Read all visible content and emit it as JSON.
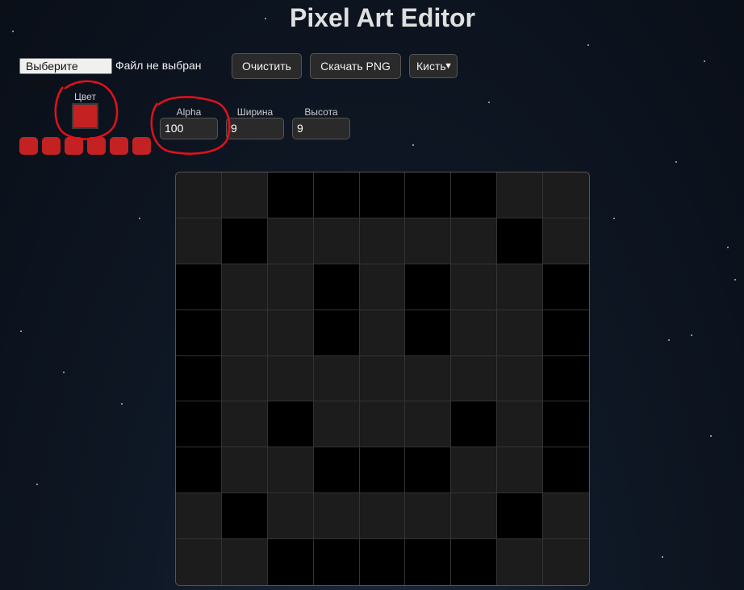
{
  "app_title": "Pixel Art Editor",
  "file_input": {
    "button_label": "Выберите файл",
    "status": "Файл не выбран"
  },
  "toolbar": {
    "clear_label": "Очистить",
    "download_label": "Скачать PNG",
    "tool_select_value": "Кисть"
  },
  "color": {
    "label": "Цвет",
    "value": "#c42222"
  },
  "alpha": {
    "label": "Alpha",
    "value": "100"
  },
  "width": {
    "label": "Ширина",
    "value": "9"
  },
  "height": {
    "label": "Высота",
    "value": "9"
  },
  "palette": [
    "#c42222",
    "#c42222",
    "#c42222",
    "#c42222",
    "#c42222",
    "#c42222"
  ],
  "canvas": {
    "rows": 9,
    "cols": 9,
    "empty_color": "#1c1c1c",
    "filled_color": "#000000",
    "pixels": [
      [
        0,
        0,
        1,
        1,
        1,
        1,
        1,
        0,
        0
      ],
      [
        0,
        1,
        0,
        0,
        0,
        0,
        0,
        1,
        0
      ],
      [
        1,
        0,
        0,
        1,
        0,
        1,
        0,
        0,
        1
      ],
      [
        1,
        0,
        0,
        1,
        0,
        1,
        0,
        0,
        1
      ],
      [
        1,
        0,
        0,
        0,
        0,
        0,
        0,
        0,
        1
      ],
      [
        1,
        0,
        1,
        0,
        0,
        0,
        1,
        0,
        1
      ],
      [
        1,
        0,
        0,
        1,
        1,
        1,
        0,
        0,
        1
      ],
      [
        0,
        1,
        0,
        0,
        0,
        0,
        0,
        1,
        0
      ],
      [
        0,
        0,
        1,
        1,
        1,
        1,
        1,
        0,
        0
      ]
    ]
  },
  "annotation_color": "#e3111b"
}
